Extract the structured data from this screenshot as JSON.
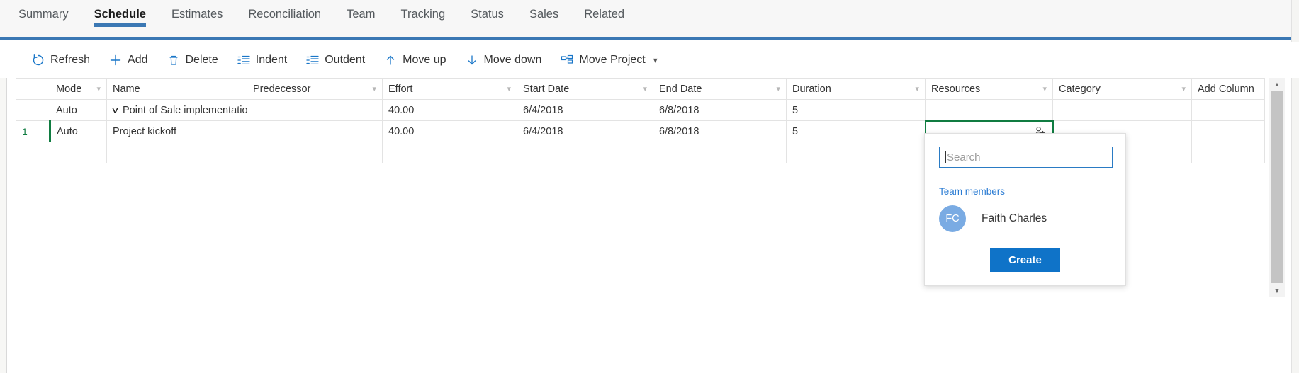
{
  "tabs": [
    {
      "label": "Summary",
      "active": false
    },
    {
      "label": "Schedule",
      "active": true
    },
    {
      "label": "Estimates",
      "active": false
    },
    {
      "label": "Reconciliation",
      "active": false
    },
    {
      "label": "Team",
      "active": false
    },
    {
      "label": "Tracking",
      "active": false
    },
    {
      "label": "Status",
      "active": false
    },
    {
      "label": "Sales",
      "active": false
    },
    {
      "label": "Related",
      "active": false
    }
  ],
  "toolbar": {
    "refresh_label": "Refresh",
    "add_label": "Add",
    "delete_label": "Delete",
    "indent_label": "Indent",
    "outdent_label": "Outdent",
    "move_up_label": "Move up",
    "move_down_label": "Move down",
    "move_project_label": "Move Project"
  },
  "grid": {
    "columns": [
      {
        "label": "",
        "chevron": false
      },
      {
        "label": "Mode",
        "chevron": true
      },
      {
        "label": "Name",
        "chevron": false
      },
      {
        "label": "Predecessor",
        "chevron": true
      },
      {
        "label": "Effort",
        "chevron": true
      },
      {
        "label": "Start Date",
        "chevron": true
      },
      {
        "label": "End Date",
        "chevron": true
      },
      {
        "label": "Duration",
        "chevron": true
      },
      {
        "label": "Resources",
        "chevron": true
      },
      {
        "label": "Category",
        "chevron": true
      },
      {
        "label": "Add Column",
        "chevron": false
      }
    ],
    "rows": [
      {
        "rowno": "",
        "mode": "Auto",
        "name": "Point of Sale implementatio",
        "predecessor": "",
        "effort": "40.00",
        "start_date": "6/4/2018",
        "end_date": "6/8/2018",
        "duration": "5",
        "resources": "",
        "category": ""
      },
      {
        "rowno": "1",
        "mode": "Auto",
        "name": "Project kickoff",
        "predecessor": "",
        "effort": "40.00",
        "start_date": "6/4/2018",
        "end_date": "6/8/2018",
        "duration": "5",
        "resources": "",
        "category": ""
      },
      {
        "rowno": "",
        "mode": "",
        "name": "",
        "predecessor": "",
        "effort": "",
        "start_date": "",
        "end_date": "",
        "duration": "",
        "resources": "",
        "category": ""
      }
    ]
  },
  "popup": {
    "search_placeholder": "Search",
    "search_value": "",
    "team_label": "Team members",
    "members": [
      {
        "initials": "FC",
        "name": "Faith Charles"
      }
    ],
    "create_label": "Create"
  },
  "colors": {
    "accent_blue": "#3b78b4",
    "link_blue": "#2b7cd3",
    "button_blue": "#0f73c8",
    "active_green": "#107c41",
    "avatar_blue": "#7aabe3"
  }
}
